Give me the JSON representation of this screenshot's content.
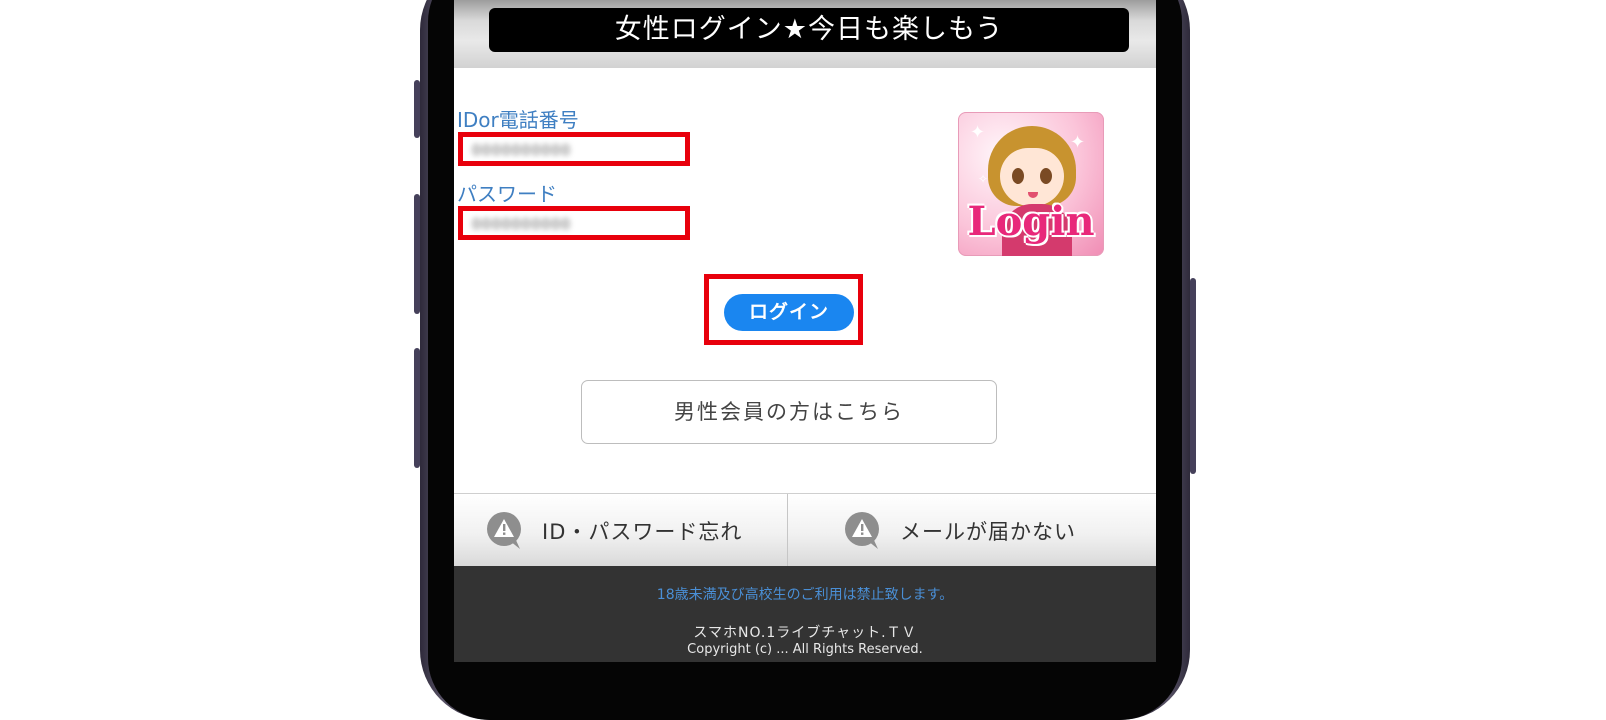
{
  "header": {
    "title": "女性ログイン★今日も楽しもう"
  },
  "login_form": {
    "id_label": "IDor電話番号",
    "id_value": "0000000000",
    "password_label": "パスワード",
    "password_value": "0000000000",
    "login_button_label": "ログイン",
    "login_image_text": "Login"
  },
  "male_link": {
    "label": "男性会員の方はこちら"
  },
  "help_bar": {
    "items": [
      {
        "label": "ID・パスワード忘れ",
        "icon": "warning-chat-icon"
      },
      {
        "label": "メールが届かない",
        "icon": "warning-chat-icon"
      }
    ]
  },
  "footer": {
    "notice": "18歳未満及び高校生のご利用は禁止致します。",
    "brand": "スマホNO.1ライブチャット.ＴＶ",
    "copyright": "Copyright (c) ... All Rights Reserved."
  },
  "colors": {
    "highlight_red": "#e8000c",
    "login_button_blue": "#1a86f0",
    "label_blue": "#3f7fc2",
    "footer_bg": "#333333"
  }
}
